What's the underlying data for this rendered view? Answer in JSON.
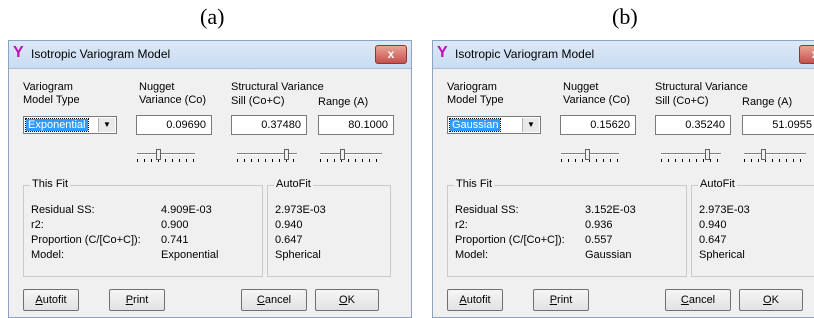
{
  "captions": {
    "a": "(a)",
    "b": "(b)"
  },
  "dialogs": [
    {
      "title": "Isotropic Variogram Model",
      "close_glyph": "x",
      "logo_glyph": "Y",
      "model_type_label_1": "Variogram",
      "model_type_label_2": "Model Type",
      "nugget_label_1": "Nugget",
      "nugget_label_2": "Variance (Co)",
      "structural_label": "Structural Variance",
      "sill_label": "Sill (Co+C)",
      "range_label": "Range (A)",
      "model_type_value": "Exponential",
      "nugget_value": "0.09690",
      "sill_value": "0.37480",
      "range_value": "80.1000",
      "slider_levels": {
        "nugget": 0.35,
        "sill": 0.85,
        "range": 0.35
      },
      "this_fit": {
        "title": "This Fit",
        "rows": [
          {
            "label": "Residual SS:",
            "value": "4.909E-03"
          },
          {
            "label": "r2:",
            "value": "0.900"
          },
          {
            "label": "Proportion (C/[Co+C]):",
            "value": "0.741"
          },
          {
            "label": "Model:",
            "value": "Exponential"
          }
        ]
      },
      "autofit": {
        "title": "AutoFit",
        "values": [
          "2.973E-03",
          "0.940",
          "0.647",
          "Spherical"
        ]
      },
      "buttons": {
        "autofit": {
          "first": "A",
          "rest": "utofit"
        },
        "print": {
          "first": "P",
          "rest": "rint"
        },
        "cancel": {
          "first": "C",
          "rest": "ancel"
        },
        "ok": {
          "first": "O",
          "rest": "K"
        }
      }
    },
    {
      "title": "Isotropic Variogram Model",
      "close_glyph": "x",
      "logo_glyph": "Y",
      "model_type_label_1": "Variogram",
      "model_type_label_2": "Model Type",
      "nugget_label_1": "Nugget",
      "nugget_label_2": "Variance (Co)",
      "structural_label": "Structural Variance",
      "sill_label": "Sill (Co+C)",
      "range_label": "Range (A)",
      "model_type_value": "Gaussian",
      "nugget_value": "0.15620",
      "sill_value": "0.35240",
      "range_value": "51.0955",
      "slider_levels": {
        "nugget": 0.45,
        "sill": 0.8,
        "range": 0.3
      },
      "this_fit": {
        "title": "This Fit",
        "rows": [
          {
            "label": "Residual SS:",
            "value": "3.152E-03"
          },
          {
            "label": "r2:",
            "value": "0.936"
          },
          {
            "label": "Proportion (C/[Co+C]):",
            "value": "0.557"
          },
          {
            "label": "Model:",
            "value": "Gaussian"
          }
        ]
      },
      "autofit": {
        "title": "AutoFit",
        "values": [
          "2.973E-03",
          "0.940",
          "0.647",
          "Spherical"
        ]
      },
      "buttons": {
        "autofit": {
          "first": "A",
          "rest": "utofit"
        },
        "print": {
          "first": "P",
          "rest": "rint"
        },
        "cancel": {
          "first": "C",
          "rest": "ancel"
        },
        "ok": {
          "first": "O",
          "rest": "K"
        }
      }
    }
  ]
}
